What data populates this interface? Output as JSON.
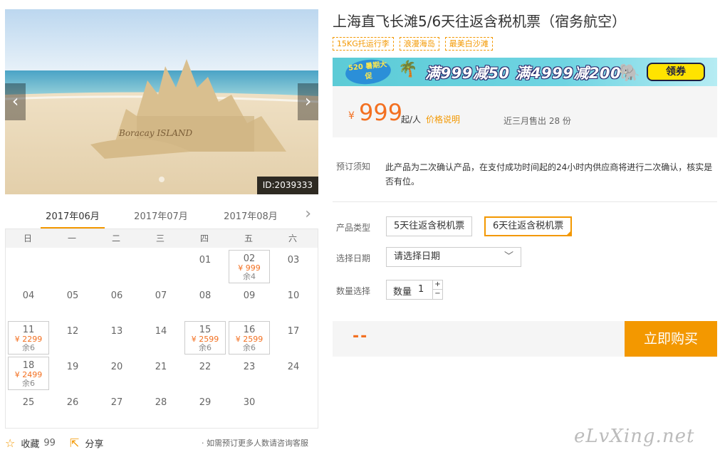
{
  "gallery": {
    "photo_caption": "Boracay ISLAND",
    "image_id": "ID:2039333",
    "prev_arrow": "‹",
    "next_arrow": "›"
  },
  "calendar": {
    "months": [
      "2017年06月",
      "2017年07月",
      "2017年08月"
    ],
    "active_month_index": 0,
    "next_arrow": "›",
    "weekdays": [
      "日",
      "一",
      "二",
      "三",
      "四",
      "五",
      "六"
    ],
    "days": [
      {
        "day": "01",
        "col": 4,
        "row": 0
      },
      {
        "day": "02",
        "col": 5,
        "row": 0,
        "price": "¥ 999",
        "remain": "余4"
      },
      {
        "day": "03",
        "col": 6,
        "row": 0
      },
      {
        "day": "04",
        "col": 0,
        "row": 1
      },
      {
        "day": "05",
        "col": 1,
        "row": 1
      },
      {
        "day": "06",
        "col": 2,
        "row": 1
      },
      {
        "day": "07",
        "col": 3,
        "row": 1
      },
      {
        "day": "08",
        "col": 4,
        "row": 1
      },
      {
        "day": "09",
        "col": 5,
        "row": 1
      },
      {
        "day": "10",
        "col": 6,
        "row": 1
      },
      {
        "day": "11",
        "col": 0,
        "row": 2,
        "price": "¥ 2299",
        "remain": "余6"
      },
      {
        "day": "12",
        "col": 1,
        "row": 2
      },
      {
        "day": "13",
        "col": 2,
        "row": 2
      },
      {
        "day": "14",
        "col": 3,
        "row": 2
      },
      {
        "day": "15",
        "col": 4,
        "row": 2,
        "price": "¥ 2599",
        "remain": "余6"
      },
      {
        "day": "16",
        "col": 5,
        "row": 2,
        "price": "¥ 2599",
        "remain": "余6"
      },
      {
        "day": "17",
        "col": 6,
        "row": 2
      },
      {
        "day": "18",
        "col": 0,
        "row": 3,
        "price": "¥ 2499",
        "remain": "余6"
      },
      {
        "day": "19",
        "col": 1,
        "row": 3
      },
      {
        "day": "20",
        "col": 2,
        "row": 3
      },
      {
        "day": "21",
        "col": 3,
        "row": 3
      },
      {
        "day": "22",
        "col": 4,
        "row": 3
      },
      {
        "day": "23",
        "col": 5,
        "row": 3
      },
      {
        "day": "24",
        "col": 6,
        "row": 3
      },
      {
        "day": "25",
        "col": 0,
        "row": 4
      },
      {
        "day": "26",
        "col": 1,
        "row": 4
      },
      {
        "day": "27",
        "col": 2,
        "row": 4
      },
      {
        "day": "28",
        "col": 3,
        "row": 4
      },
      {
        "day": "29",
        "col": 4,
        "row": 4
      },
      {
        "day": "30",
        "col": 5,
        "row": 4
      }
    ]
  },
  "actions": {
    "favorite_label": "收藏",
    "favorite_count": "99",
    "share_label": "分享",
    "note": "· 如需预订更多人数请咨询客服"
  },
  "product": {
    "title": "上海直飞长滩5/6天往返含税机票（宿务航空）",
    "tags": [
      "15KG托运行李",
      "浪漫海岛",
      "最美白沙滩"
    ]
  },
  "banner": {
    "badge": "520 暑期大促",
    "promo_text": "满999减50  满4999减200",
    "coupon_label": "领券"
  },
  "price": {
    "currency": "¥",
    "amount": "999",
    "unit": "起/人",
    "explain_link": "价格说明",
    "sold": "近三月售出 28 份"
  },
  "booking": {
    "notice_label": "预订须知",
    "notice_text": "此产品为二次确认产品，在支付成功时间起的24小时内供应商将进行二次确认，核实是否有位。",
    "type_label": "产品类型",
    "types": [
      "5天往返含税机票",
      "6天往返含税机票"
    ],
    "selected_type_index": 1,
    "date_label": "选择日期",
    "date_placeholder": "请选择日期",
    "qty_label": "数量选择",
    "qty_inner_label": "数量",
    "qty_value": "1"
  },
  "order": {
    "total": "--",
    "buy_label": "立即购买"
  },
  "watermark": "eLvXing.net",
  "colors": {
    "accent": "#f39800",
    "price": "#f37021"
  }
}
